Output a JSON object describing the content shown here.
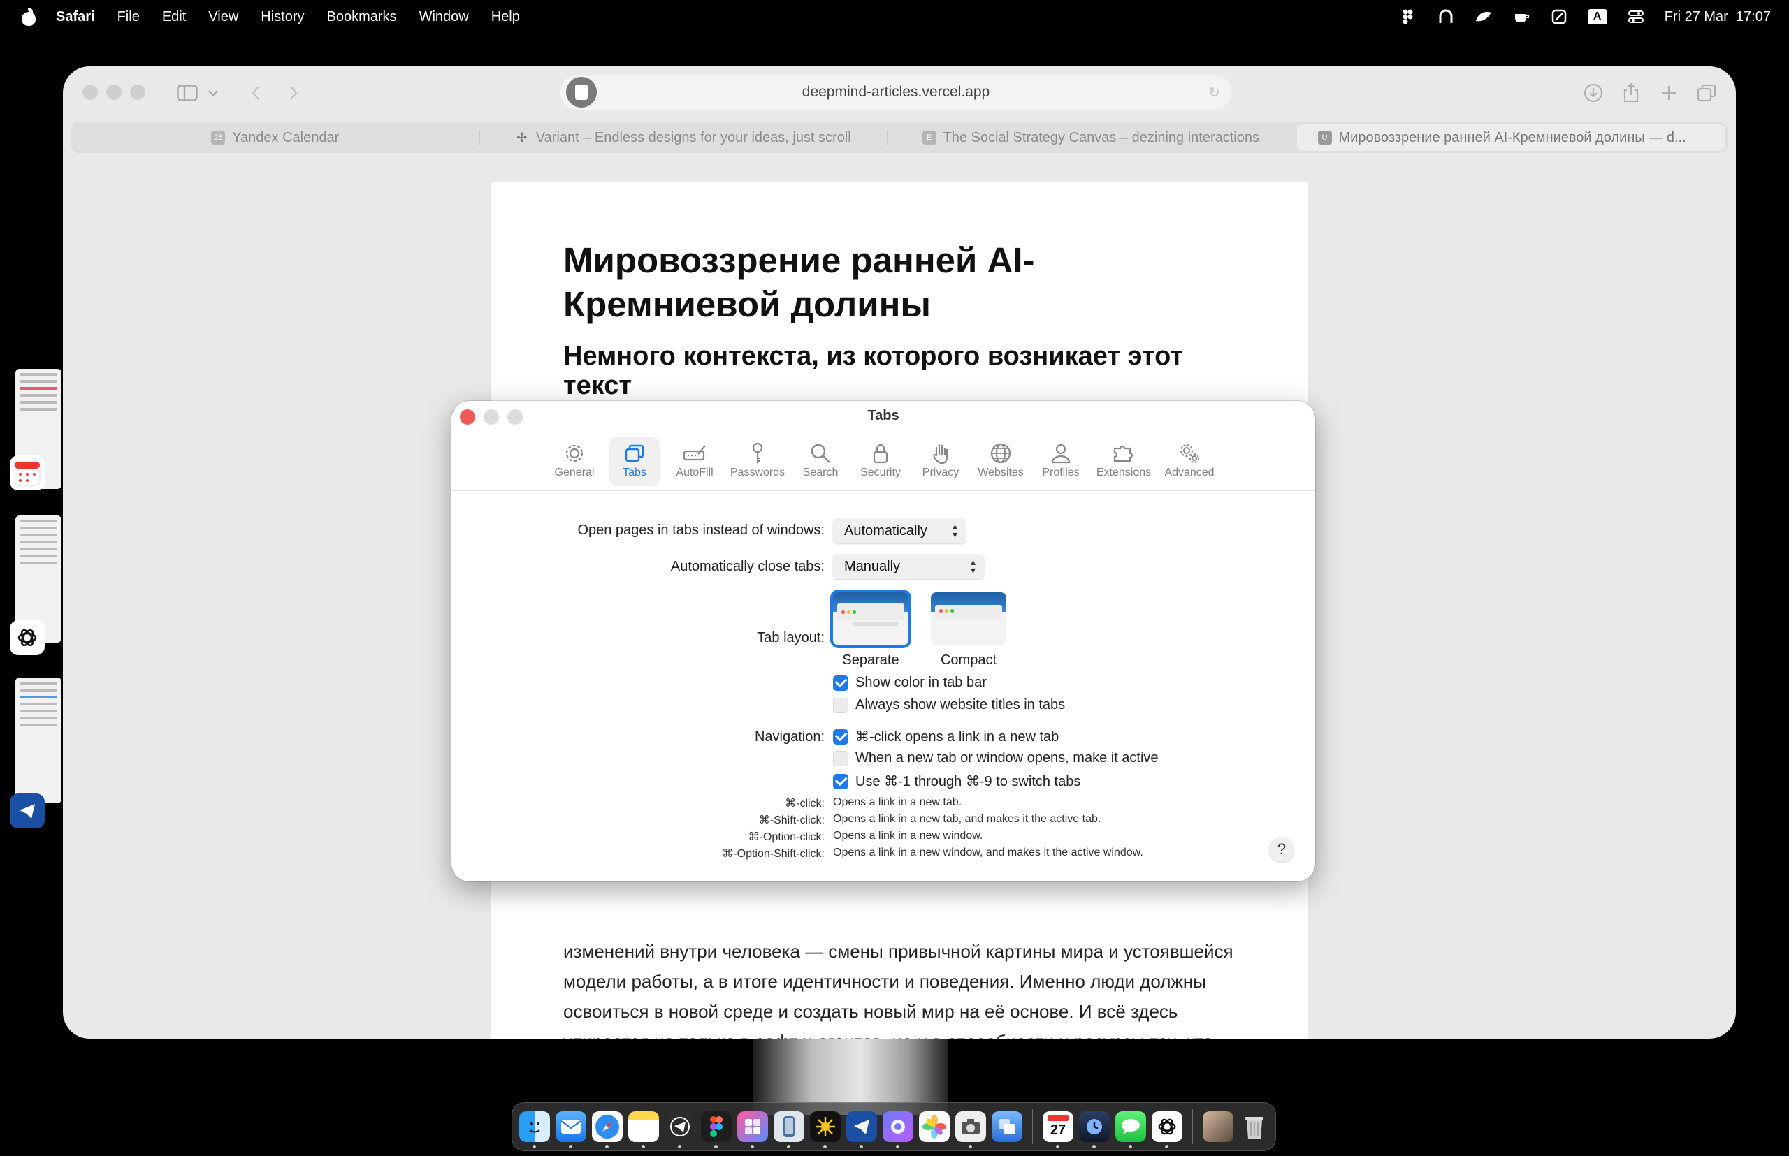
{
  "menubar": {
    "app": "Safari",
    "items": [
      "Safari",
      "File",
      "Edit",
      "View",
      "History",
      "Bookmarks",
      "Window",
      "Help"
    ],
    "input_indicator": "A",
    "clock": "Fri 27 Mar  17:07"
  },
  "browser": {
    "url": "deepmind-articles.vercel.app",
    "tabs": [
      {
        "title": "Yandex Calendar",
        "favicon": "26"
      },
      {
        "title": "Variant – Endless designs for your ideas, just scroll",
        "favicon": "✣"
      },
      {
        "title": "The Social Strategy Canvas – dezining interactions",
        "favicon": "E"
      },
      {
        "title": "Мировоззрение ранней AI-Кремниевой долины — d...",
        "favicon": "U",
        "active": true
      }
    ]
  },
  "article": {
    "title": "Мировоззрение ранней AI-Кремниевой долины",
    "subtitle": "Немного контекста, из которого возникает этот текст",
    "body": "изменений внутри человека — смены привычной картины мира и устоявшейся модели работы, а в итоге идентичности и поведения. Именно люди должны освоиться в новой среде и создать новый мир на её основе. И всё здесь упирается не только в софт и агентов, но и в способности и ресурсы тех, кто всем этим пользуется."
  },
  "settings": {
    "window_title": "Tabs",
    "toolbar": [
      {
        "label": "General",
        "icon": "gear-icon"
      },
      {
        "label": "Tabs",
        "icon": "tabs-icon",
        "active": true
      },
      {
        "label": "AutoFill",
        "icon": "autofill-icon"
      },
      {
        "label": "Passwords",
        "icon": "key-icon"
      },
      {
        "label": "Search",
        "icon": "search-icon"
      },
      {
        "label": "Security",
        "icon": "lock-icon"
      },
      {
        "label": "Privacy",
        "icon": "hand-icon"
      },
      {
        "label": "Websites",
        "icon": "globe-icon"
      },
      {
        "label": "Profiles",
        "icon": "person-icon"
      },
      {
        "label": "Extensions",
        "icon": "puzzle-icon"
      },
      {
        "label": "Advanced",
        "icon": "gears-icon"
      }
    ],
    "open_pages_label": "Open pages in tabs instead of windows:",
    "open_pages_value": "Automatically",
    "close_tabs_label": "Automatically close tabs:",
    "close_tabs_value": "Manually",
    "tab_layout_label": "Tab layout:",
    "layout_separate": "Separate",
    "layout_compact": "Compact",
    "selected_layout": "Separate",
    "show_color": {
      "label": "Show color in tab bar",
      "checked": true
    },
    "always_titles": {
      "label": "Always show website titles in tabs",
      "checked": false
    },
    "navigation_label": "Navigation:",
    "nav_cmd_click": {
      "label": "⌘-click opens a link in a new tab",
      "checked": true
    },
    "nav_make_active": {
      "label": "When a new tab or window opens, make it active",
      "checked": false
    },
    "nav_switch": {
      "label": "Use ⌘-1 through ⌘-9 to switch tabs",
      "checked": true
    },
    "hints": [
      {
        "key": "⌘-click:",
        "value": "Opens a link in a new tab."
      },
      {
        "key": "⌘-Shift-click:",
        "value": "Opens a link in a new tab, and makes it the active tab."
      },
      {
        "key": "⌘-Option-click:",
        "value": "Opens a link in a new window."
      },
      {
        "key": "⌘-Option-Shift-click:",
        "value": "Opens a link in a new window, and makes it the active window."
      }
    ],
    "help_label": "?"
  },
  "dock": {
    "apps": [
      "Finder",
      "Mail",
      "Safari",
      "Notes",
      "Telegram",
      "Figma",
      "Craft",
      "Simulator",
      "Perplexity",
      "Telegram Lite",
      "Arc",
      "Photos",
      "Screenshot",
      "Screen Sharing",
      "Calendar",
      "Screen Time",
      "Messages",
      "ChatGPT",
      "Downloads",
      "Trash"
    ],
    "calendar_day": "27"
  },
  "colors": {
    "accent": "#1f7ae8",
    "close": "#ee5b56"
  }
}
